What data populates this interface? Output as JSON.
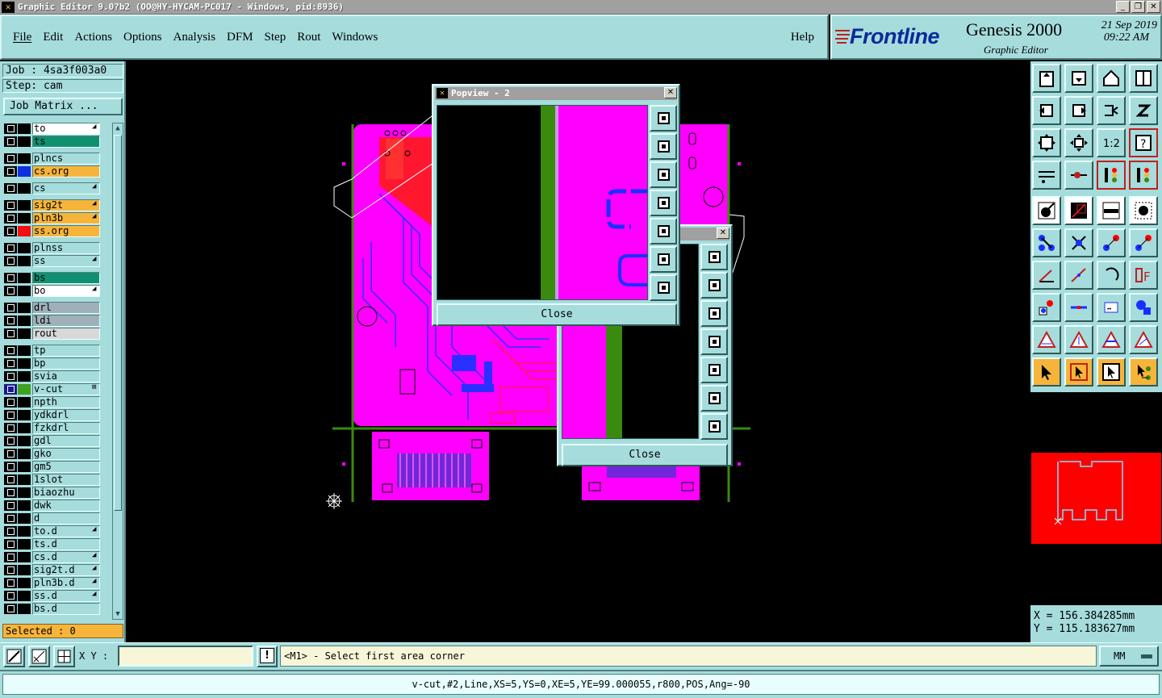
{
  "window": {
    "title": "Graphic Editor 9.0?b2 (OO@HY-HYCAM-PC017 - Windows, pid:8936)"
  },
  "menu": {
    "items": [
      "File",
      "Edit",
      "Actions",
      "Options",
      "Analysis",
      "DFM",
      "Step",
      "Rout",
      "Windows"
    ],
    "help": "Help"
  },
  "brand": {
    "logo": "Frontline",
    "product": "Genesis 2000",
    "subtitle": "Graphic Editor",
    "date_line1": "21 Sep 2019",
    "date_line2": "09:22 AM"
  },
  "job": {
    "job_label": "Job : 4sa3f003a0",
    "step_label": "Step: cam",
    "matrix_button": "Job Matrix ..."
  },
  "layers": [
    {
      "name": "to",
      "bg": "#ffffff",
      "color": "#000000",
      "flag": "◢"
    },
    {
      "name": "ts",
      "bg": "#109070",
      "color": "#000000",
      "flag": ""
    },
    {
      "name": "plncs",
      "bg": "#a6dcdc",
      "color": "#000000",
      "flag": ""
    },
    {
      "name": "cs.org",
      "bg": "#f6b43a",
      "color": "#1030e0",
      "flag": ""
    },
    {
      "name": "cs",
      "bg": "#a6dcdc",
      "color": "#000000",
      "flag": "◢"
    },
    {
      "name": "sig2t",
      "bg": "#f6b43a",
      "color": "#000000",
      "flag": "◢"
    },
    {
      "name": "pln3b",
      "bg": "#f6b43a",
      "color": "#000000",
      "flag": "◢"
    },
    {
      "name": "ss.org",
      "bg": "#f6b43a",
      "color": "#f01010",
      "flag": ""
    },
    {
      "name": "plnss",
      "bg": "#a6dcdc",
      "color": "#000000",
      "flag": ""
    },
    {
      "name": "ss",
      "bg": "#a6dcdc",
      "color": "#000000",
      "flag": "◢"
    },
    {
      "name": "bs",
      "bg": "#109070",
      "color": "#000000",
      "flag": ""
    },
    {
      "name": "bo",
      "bg": "#ffffff",
      "color": "#000000",
      "flag": "◢"
    },
    {
      "name": "drl",
      "bg": "#9fb0b8",
      "color": "#000000",
      "flag": ""
    },
    {
      "name": "ldi",
      "bg": "#9fb0b8",
      "color": "#000000",
      "flag": ""
    },
    {
      "name": "rout",
      "bg": "#d8d8d8",
      "color": "#000000",
      "flag": ""
    },
    {
      "name": "tp",
      "bg": "#a6dcdc",
      "color": "#000000",
      "flag": ""
    },
    {
      "name": "bp",
      "bg": "#a6dcdc",
      "color": "#000000",
      "flag": ""
    },
    {
      "name": "svia",
      "bg": "#a6dcdc",
      "color": "#000000",
      "flag": ""
    },
    {
      "name": "v-cut",
      "bg": "#a6dcdc",
      "color": "#40a020",
      "flag": "⊞"
    },
    {
      "name": "npth",
      "bg": "#a6dcdc",
      "color": "#000000",
      "flag": ""
    },
    {
      "name": "ydkdrl",
      "bg": "#a6dcdc",
      "color": "#000000",
      "flag": ""
    },
    {
      "name": "fzkdrl",
      "bg": "#a6dcdc",
      "color": "#000000",
      "flag": ""
    },
    {
      "name": "gdl",
      "bg": "#a6dcdc",
      "color": "#000000",
      "flag": ""
    },
    {
      "name": "gko",
      "bg": "#a6dcdc",
      "color": "#000000",
      "flag": ""
    },
    {
      "name": "gm5",
      "bg": "#a6dcdc",
      "color": "#000000",
      "flag": ""
    },
    {
      "name": "1slot",
      "bg": "#a6dcdc",
      "color": "#000000",
      "flag": ""
    },
    {
      "name": "biaozhu",
      "bg": "#a6dcdc",
      "color": "#000000",
      "flag": ""
    },
    {
      "name": "dwk",
      "bg": "#a6dcdc",
      "color": "#000000",
      "flag": ""
    },
    {
      "name": "d",
      "bg": "#a6dcdc",
      "color": "#000000",
      "flag": ""
    },
    {
      "name": "to.d",
      "bg": "#a6dcdc",
      "color": "#000000",
      "flag": "◢"
    },
    {
      "name": "ts.d",
      "bg": "#a6dcdc",
      "color": "#000000",
      "flag": ""
    },
    {
      "name": "cs.d",
      "bg": "#a6dcdc",
      "color": "#000000",
      "flag": "◢"
    },
    {
      "name": "sig2t.d",
      "bg": "#a6dcdc",
      "color": "#000000",
      "flag": "◢"
    },
    {
      "name": "pln3b.d",
      "bg": "#a6dcdc",
      "color": "#000000",
      "flag": "◢"
    },
    {
      "name": "ss.d",
      "bg": "#a6dcdc",
      "color": "#000000",
      "flag": "◢"
    },
    {
      "name": "bs.d",
      "bg": "#a6dcdc",
      "color": "#000000",
      "flag": ""
    }
  ],
  "selected": "Selected : 0",
  "popview1": {
    "title": "Popview - 2",
    "close_label": "Close"
  },
  "popview2": {
    "close_label": "Close"
  },
  "coords": {
    "x": "X  =  156.384285mm",
    "y": "Y  =  115.183627mm"
  },
  "command": {
    "xy_label": "X Y :",
    "xy_value": "",
    "alert_icon": "!",
    "message": "<M1> - Select first area corner",
    "units": "MM"
  },
  "status": "v-cut,#2,Line,XS=5,YS=0,XE=5,YE=99.000055,r800,POS,Ang=-90",
  "colors": {
    "panel": "#a6dcdc",
    "magenta": "#ff00ff",
    "vcut": "#3a8a10",
    "accent_orange": "#f6b43a"
  }
}
